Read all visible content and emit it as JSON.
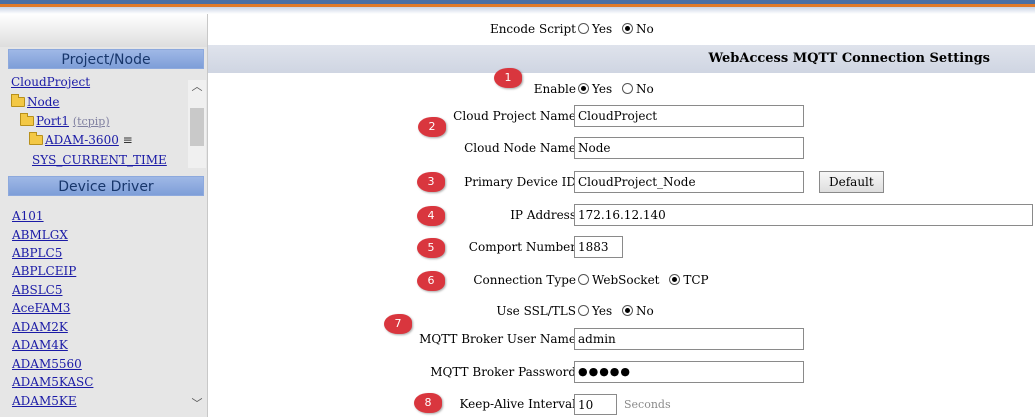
{
  "sidebar": {
    "project_header": "Project/Node",
    "tree": {
      "project": "CloudProject",
      "node": "Node",
      "port": "Port1",
      "port_type": "(tcpip)",
      "device": "ADAM-3600",
      "tag": "SYS_CURRENT_TIME"
    },
    "driver_header": "Device Driver",
    "drivers": [
      "A101",
      "ABMLGX",
      "ABPLC5",
      "ABPLCEIP",
      "ABSLC5",
      "AceFAM3",
      "ADAM2K",
      "ADAM4K",
      "ADAM5560",
      "ADAM5KASC",
      "ADAM5KE"
    ]
  },
  "main": {
    "encode_script": {
      "label": "Encode Script",
      "options": [
        "Yes",
        "No"
      ],
      "selected": "No"
    },
    "section_title": "WebAccess MQTT Connection Settings",
    "enable": {
      "label": "Enable",
      "options": [
        "Yes",
        "No"
      ],
      "selected": "Yes"
    },
    "cloud_project_name": {
      "label": "Cloud Project Name",
      "value": "CloudProject"
    },
    "cloud_node_name": {
      "label": "Cloud Node Name",
      "value": "Node"
    },
    "primary_device_id": {
      "label": "Primary Device ID",
      "value": "CloudProject_Node",
      "button": "Default"
    },
    "ip_address": {
      "label": "IP Address",
      "value": "172.16.12.140"
    },
    "comport_number": {
      "label": "Comport Number",
      "value": "1883"
    },
    "connection_type": {
      "label": "Connection Type",
      "options": [
        "WebSocket",
        "TCP"
      ],
      "selected": "TCP"
    },
    "use_ssl": {
      "label": "Use SSL/TLS",
      "options": [
        "Yes",
        "No"
      ],
      "selected": "No"
    },
    "broker_user": {
      "label": "MQTT Broker User Name",
      "value": "admin"
    },
    "broker_password": {
      "label": "MQTT Broker Password",
      "value": "●●●●●"
    },
    "keep_alive": {
      "label": "Keep-Alive Interval",
      "value": "10",
      "unit": "Seconds"
    }
  },
  "badges": [
    "1",
    "2",
    "3",
    "4",
    "5",
    "6",
    "7",
    "8"
  ],
  "colors": {
    "accent_blue": "#7e9ed8",
    "badge_red": "#d9363e",
    "banner_orange": "#e07a2a"
  }
}
